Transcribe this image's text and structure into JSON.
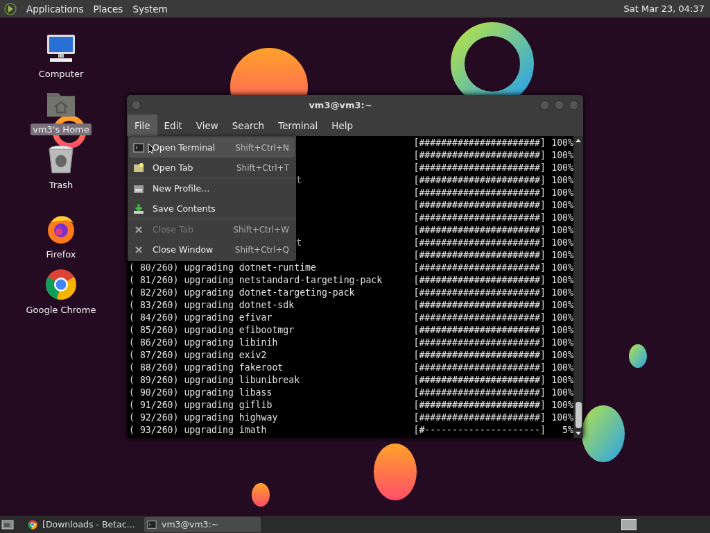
{
  "top_panel": {
    "menus": [
      "Applications",
      "Places",
      "System"
    ],
    "clock": "Sat Mar 23, 04:37"
  },
  "desktop_icons": [
    {
      "kind": "computer",
      "label": "Computer",
      "selected": false
    },
    {
      "kind": "home",
      "label": "vm3's Home",
      "selected": true
    },
    {
      "kind": "trash",
      "label": "Trash",
      "selected": false
    },
    {
      "kind": "firefox",
      "label": "Firefox",
      "selected": false
    },
    {
      "kind": "chrome",
      "label": "Google Chrome",
      "selected": false
    }
  ],
  "window": {
    "title": "vm3@vm3:~",
    "menubar": [
      {
        "label": "File",
        "selected": true
      },
      {
        "label": "Edit",
        "selected": false
      },
      {
        "label": "View",
        "selected": false
      },
      {
        "label": "Search",
        "selected": false
      },
      {
        "label": "Terminal",
        "selected": false
      },
      {
        "label": "Help",
        "selected": false
      }
    ],
    "file_menu": [
      {
        "kind": "terminal",
        "label": "Open Terminal",
        "shortcut": "Shift+Ctrl+N",
        "highlighted": true,
        "disabled": false
      },
      {
        "kind": "tab",
        "label": "Open Tab",
        "shortcut": "Shift+Ctrl+T",
        "highlighted": false,
        "disabled": false
      },
      {
        "kind": "separator"
      },
      {
        "kind": "profile",
        "label": "New Profile…",
        "highlighted": false,
        "disabled": false
      },
      {
        "kind": "save",
        "label": "Save Contents",
        "highlighted": false,
        "disabled": false
      },
      {
        "kind": "separator"
      },
      {
        "kind": "close",
        "label": "Close Tab",
        "shortcut": "Shift+Ctrl+W",
        "highlighted": false,
        "disabled": true
      },
      {
        "kind": "close",
        "label": "Close Window",
        "shortcut": "Shift+Ctrl+Q",
        "highlighted": false,
        "disabled": false
      }
    ],
    "terminal_lines": [
      {
        "kind": "partial",
        "bar": "[######################]",
        "percent": "100%"
      },
      {
        "kind": "partial",
        "bar": "[######################]",
        "percent": "100%"
      },
      {
        "kind": "partial",
        "bar": "[######################]",
        "percent": "100%"
      },
      {
        "kind": "partial",
        "text": "t",
        "bar": "[######################]",
        "percent": "100%"
      },
      {
        "kind": "partial",
        "bar": "[######################]",
        "percent": "100%"
      },
      {
        "kind": "partial",
        "bar": "[######################]",
        "percent": "100%"
      },
      {
        "kind": "partial",
        "bar": "[######################]",
        "percent": "100%"
      },
      {
        "kind": "partial",
        "bar": "[######################]",
        "percent": "100%"
      },
      {
        "kind": "partial",
        "text": "t",
        "bar": "[######################]",
        "percent": "100%"
      },
      {
        "kind": "partial",
        "bar": "[######################]",
        "percent": "100%"
      },
      {
        "kind": "full",
        "text": "( 80/260) upgrading dotnet-runtime",
        "bar": "[######################]",
        "percent": "100%"
      },
      {
        "kind": "full",
        "text": "( 81/260) upgrading netstandard-targeting-pack",
        "bar": "[######################]",
        "percent": "100%"
      },
      {
        "kind": "full",
        "text": "( 82/260) upgrading dotnet-targeting-pack",
        "bar": "[######################]",
        "percent": "100%"
      },
      {
        "kind": "full",
        "text": "( 83/260) upgrading dotnet-sdk",
        "bar": "[######################]",
        "percent": "100%"
      },
      {
        "kind": "full",
        "text": "( 84/260) upgrading efivar",
        "bar": "[######################]",
        "percent": "100%"
      },
      {
        "kind": "full",
        "text": "( 85/260) upgrading efibootmgr",
        "bar": "[######################]",
        "percent": "100%"
      },
      {
        "kind": "full",
        "text": "( 86/260) upgrading libinih",
        "bar": "[######################]",
        "percent": "100%"
      },
      {
        "kind": "full",
        "text": "( 87/260) upgrading exiv2",
        "bar": "[######################]",
        "percent": "100%"
      },
      {
        "kind": "full",
        "text": "( 88/260) upgrading fakeroot",
        "bar": "[######################]",
        "percent": "100%"
      },
      {
        "kind": "full",
        "text": "( 89/260) upgrading libunibreak",
        "bar": "[######################]",
        "percent": "100%"
      },
      {
        "kind": "full",
        "text": "( 90/260) upgrading libass",
        "bar": "[######################]",
        "percent": "100%"
      },
      {
        "kind": "full",
        "text": "( 91/260) upgrading giflib",
        "bar": "[######################]",
        "percent": "100%"
      },
      {
        "kind": "full",
        "text": "( 92/260) upgrading highway",
        "bar": "[######################]",
        "percent": "100%"
      },
      {
        "kind": "full",
        "text": "( 93/260) upgrading imath",
        "bar": "[#---------------------]",
        "percent": "5%"
      }
    ]
  },
  "taskbar": {
    "items": [
      {
        "kind": "chrome",
        "label": "[Downloads - Betac...",
        "selected": false
      },
      {
        "kind": "terminal",
        "label": "vm3@vm3:~",
        "selected": true
      }
    ]
  }
}
